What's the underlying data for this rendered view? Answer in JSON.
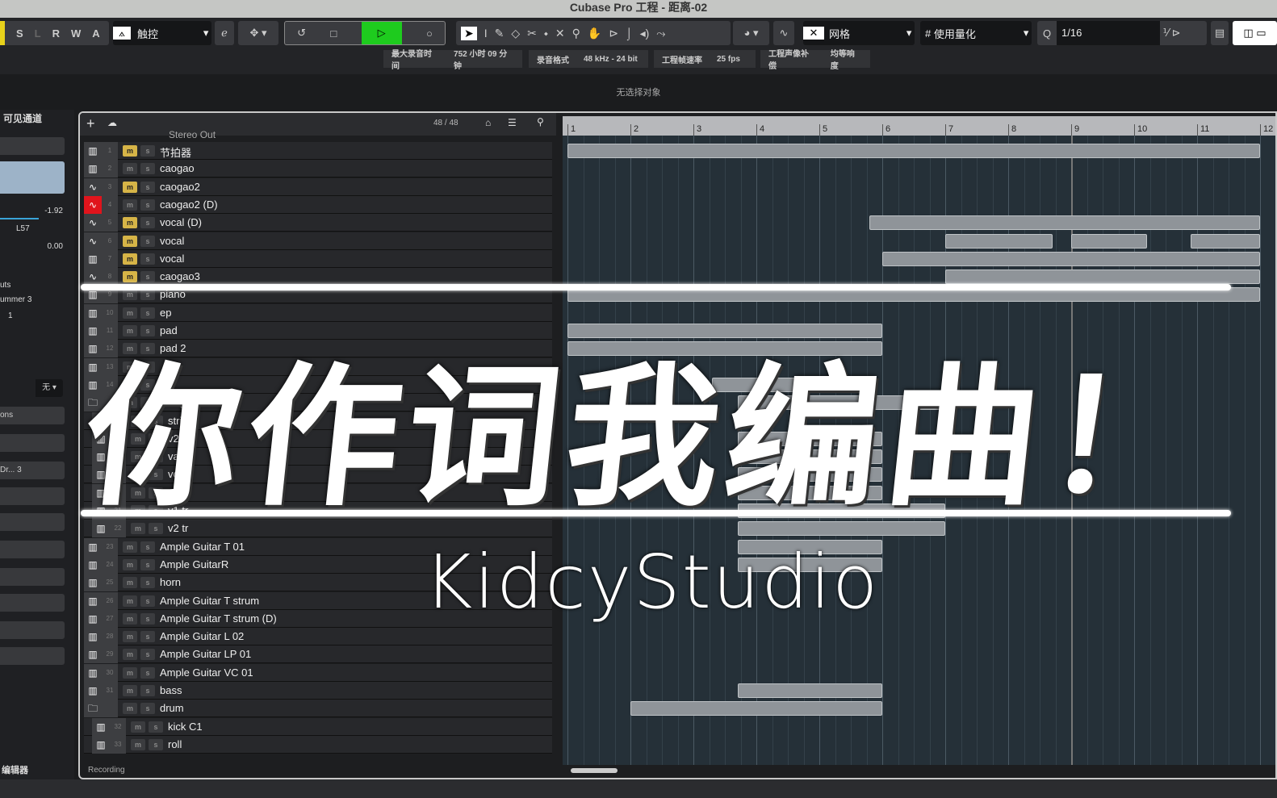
{
  "window": {
    "title": "Cubase Pro 工程 - 距离-02"
  },
  "toolbar": {
    "modes": [
      "S",
      "L",
      "R",
      "W",
      "A"
    ],
    "automation_mode": "触控",
    "grid_type": "网格",
    "quantize_mode": "使用量化",
    "quantize_value": "1/16",
    "q_label": "Q"
  },
  "infobar": {
    "max_rec_label": "最大录音时间",
    "max_rec_value": "752 小时 09 分钟",
    "rec_format_label": "录音格式",
    "rec_format_value": "48 kHz - 24 bit",
    "frame_rate_label": "工程帧速率",
    "frame_rate_value": "25 fps",
    "pan_law_label": "工程声像补偿",
    "pan_law_value": "均等响度"
  },
  "status": "无选择对象",
  "inspector": {
    "header": "可见通道",
    "volume": "-1.92",
    "pan": "L57",
    "delay": "0.00",
    "outputs_label": "uts",
    "instrument": "ummer 3",
    "channel": "1",
    "none_label": "无",
    "sections_label": "ons",
    "drummer": "Dr... 3",
    "footer": "编辑器"
  },
  "project": {
    "track_count": "48 / 48",
    "stereo_out": "Stereo Out",
    "footer_label": "Recording",
    "bars": [
      "1",
      "2",
      "3",
      "4",
      "5",
      "6",
      "7",
      "8",
      "9",
      "10",
      "11",
      "12"
    ],
    "tracks": [
      {
        "n": "1",
        "name": "节拍器",
        "type": "midi",
        "mute": true
      },
      {
        "n": "2",
        "name": "caogao",
        "type": "midi",
        "mute": false
      },
      {
        "n": "3",
        "name": "caogao2",
        "type": "audio",
        "mute": true
      },
      {
        "n": "4",
        "name": "caogao2 (D)",
        "type": "audio",
        "mute": false,
        "selected": true
      },
      {
        "n": "5",
        "name": "vocal (D)",
        "type": "audio",
        "mute": true
      },
      {
        "n": "6",
        "name": "vocal",
        "type": "audio",
        "mute": true
      },
      {
        "n": "7",
        "name": "vocal",
        "type": "midi",
        "mute": true
      },
      {
        "n": "8",
        "name": "caogao3",
        "type": "audio",
        "mute": true
      },
      {
        "n": "9",
        "name": "piano",
        "type": "midi",
        "mute": false
      },
      {
        "n": "10",
        "name": "ep",
        "type": "midi",
        "mute": false
      },
      {
        "n": "11",
        "name": "pad",
        "type": "midi",
        "mute": false
      },
      {
        "n": "12",
        "name": "pad 2",
        "type": "midi",
        "mute": false
      },
      {
        "n": "13",
        "name": "",
        "type": "midi",
        "mute": false
      },
      {
        "n": "14",
        "name": "",
        "type": "midi",
        "mute": false
      },
      {
        "n": "",
        "name": "string",
        "type": "folder",
        "mute": false
      },
      {
        "n": "",
        "name": "string",
        "type": "midi",
        "mute": false,
        "indent": true
      },
      {
        "n": "17",
        "name": "v2",
        "type": "midi",
        "mute": false,
        "indent": true
      },
      {
        "n": "18",
        "name": "va",
        "type": "midi",
        "mute": false,
        "indent": true
      },
      {
        "n": "19",
        "name": "vc",
        "type": "midi",
        "mute": false,
        "indent": true
      },
      {
        "n": "20",
        "name": "vb",
        "type": "midi",
        "mute": false,
        "indent": true
      },
      {
        "n": "21",
        "name": "v1 tr",
        "type": "midi",
        "mute": false,
        "indent": true
      },
      {
        "n": "22",
        "name": "v2 tr",
        "type": "midi",
        "mute": false,
        "indent": true
      },
      {
        "n": "23",
        "name": "Ample Guitar T 01",
        "type": "midi",
        "mute": false
      },
      {
        "n": "24",
        "name": "Ample GuitarR",
        "type": "midi",
        "mute": false
      },
      {
        "n": "25",
        "name": "horn",
        "type": "midi",
        "mute": false
      },
      {
        "n": "26",
        "name": "Ample Guitar T strum",
        "type": "midi",
        "mute": false
      },
      {
        "n": "27",
        "name": "Ample Guitar T strum (D)",
        "type": "midi",
        "mute": false
      },
      {
        "n": "28",
        "name": "Ample Guitar L 02",
        "type": "midi",
        "mute": false
      },
      {
        "n": "29",
        "name": "Ample Guitar LP 01",
        "type": "midi",
        "mute": false
      },
      {
        "n": "30",
        "name": "Ample Guitar VC 01",
        "type": "midi",
        "mute": false
      },
      {
        "n": "31",
        "name": "bass",
        "type": "midi",
        "mute": false
      },
      {
        "n": "",
        "name": "drum",
        "type": "folder",
        "mute": false
      },
      {
        "n": "32",
        "name": "kick C1",
        "type": "midi",
        "mute": false,
        "indent": true
      },
      {
        "n": "33",
        "name": "roll",
        "type": "midi",
        "mute": false,
        "indent": true
      }
    ],
    "clips": [
      {
        "row": 0,
        "start": 1,
        "end": 12
      },
      {
        "row": 4,
        "start": 5.8,
        "end": 12
      },
      {
        "row": 5,
        "start": 7,
        "end": 8.7
      },
      {
        "row": 5,
        "start": 9,
        "end": 10.2
      },
      {
        "row": 5,
        "start": 10.9,
        "end": 12
      },
      {
        "row": 6,
        "start": 6,
        "end": 12
      },
      {
        "row": 7,
        "start": 7,
        "end": 12
      },
      {
        "row": 8,
        "start": 1,
        "end": 12
      },
      {
        "row": 10,
        "start": 1,
        "end": 6
      },
      {
        "row": 11,
        "start": 1,
        "end": 6
      },
      {
        "row": 13,
        "start": 3.3,
        "end": 5
      },
      {
        "row": 14,
        "start": 3.7,
        "end": 7
      },
      {
        "row": 16,
        "start": 3.7,
        "end": 6
      },
      {
        "row": 17,
        "start": 3.7,
        "end": 6
      },
      {
        "row": 18,
        "start": 3.7,
        "end": 6
      },
      {
        "row": 19,
        "start": 3.7,
        "end": 6
      },
      {
        "row": 20,
        "start": 3.7,
        "end": 7
      },
      {
        "row": 21,
        "start": 3.7,
        "end": 7
      },
      {
        "row": 22,
        "start": 3.7,
        "end": 6
      },
      {
        "row": 23,
        "start": 3.7,
        "end": 6
      },
      {
        "row": 30,
        "start": 3.7,
        "end": 6
      },
      {
        "row": 31,
        "start": 2,
        "end": 6
      }
    ]
  },
  "overlay": {
    "title": "你作词我编曲！",
    "brand": "KidcyStudio"
  }
}
